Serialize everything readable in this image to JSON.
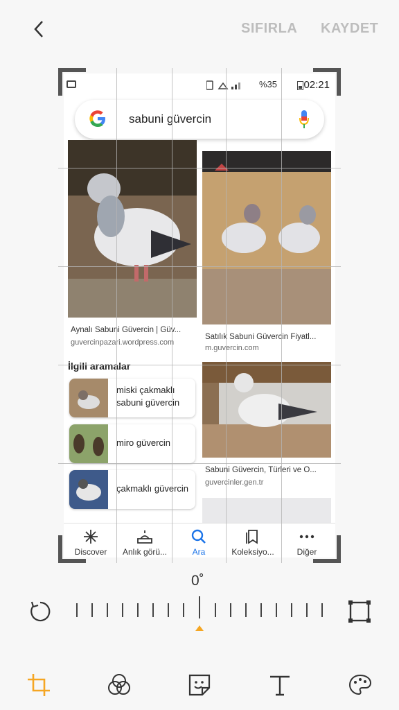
{
  "toolbar": {
    "reset_label": "SIFIRLA",
    "save_label": "KAYDET"
  },
  "status": {
    "battery": "%35",
    "time": "02:21"
  },
  "search": {
    "query": "sabuni güvercin"
  },
  "results": [
    {
      "title": "Aynalı Sabuni Güvercin | Güv...",
      "domain": "guvercinpazari.wordpress.com"
    },
    {
      "title": "Satılık Sabuni Güvercin Fiyatl...",
      "domain": "m.guvercin.com"
    },
    {
      "title": "Sabuni Güvercin, Türleri ve Ö...",
      "domain": "guvercinler.gen.tr"
    }
  ],
  "related": {
    "title": "İlgili aramalar",
    "items": [
      {
        "label": "miski çakmaklı sabuni güvercin"
      },
      {
        "label": "miro güvercin"
      },
      {
        "label": "çakmaklı güvercin"
      }
    ]
  },
  "nav": [
    {
      "label": "Discover",
      "icon": "asterisk-icon"
    },
    {
      "label": "Anlık görü...",
      "icon": "updates-icon"
    },
    {
      "label": "Ara",
      "icon": "search-icon"
    },
    {
      "label": "Koleksiyo...",
      "icon": "collections-icon"
    },
    {
      "label": "Diğer",
      "icon": "more-icon"
    }
  ],
  "rotation": {
    "angle": "0˚"
  },
  "colors": {
    "accent": "#f5a623",
    "active_nav": "#1a73e8",
    "disabled_action": "#bdbdbd"
  }
}
